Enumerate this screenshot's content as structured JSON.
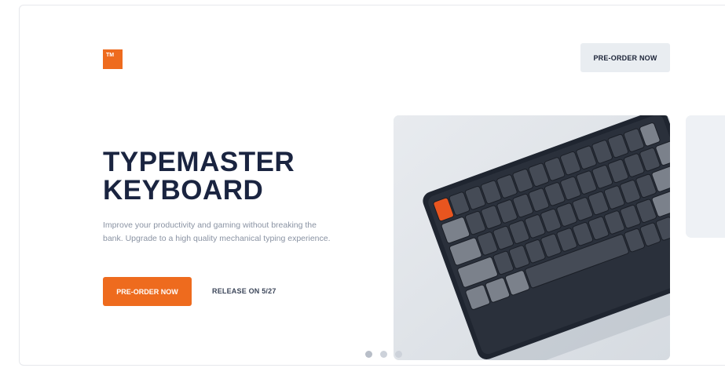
{
  "brand": {
    "logo_text": "TM",
    "accent_color": "#ee6b1e"
  },
  "header": {
    "preorder_label": "PRE-ORDER NOW"
  },
  "hero": {
    "title_line1": "TYPEMASTER",
    "title_line2": "KEYBOARD",
    "description": "Improve your productivity and gaming without breaking the bank. Upgrade to a high quality mechanical typing experience.",
    "preorder_label": "PRE-ORDER NOW",
    "release_label": "RELEASE ON 5/27"
  },
  "carousel": {
    "slide_count": 3,
    "active_index": 0,
    "main_image": "mechanical-keyboard-photo",
    "dot_icons": [
      "dot-icon",
      "dot-icon",
      "dot-icon"
    ]
  },
  "colors": {
    "title": "#1a2440",
    "secondary_button_bg": "#e9edf1",
    "keyboard_body": "#1f2530",
    "keycap_dark": "#454b56",
    "keycap_light": "#7b818b",
    "keycap_accent": "#e8551f"
  }
}
